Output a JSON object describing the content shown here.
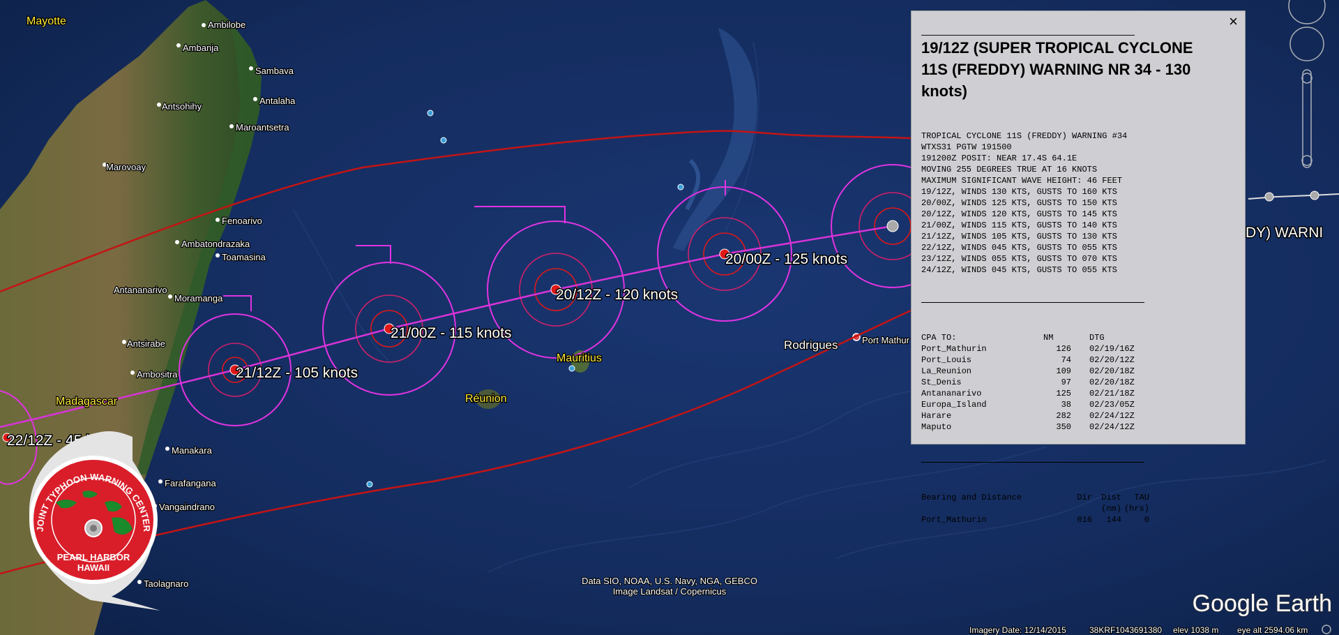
{
  "place_labels": [
    {
      "text": "Mayotte",
      "style": "yellow"
    },
    {
      "text": "Ambilobe",
      "style": "white"
    },
    {
      "text": "Ambanja",
      "style": "white"
    },
    {
      "text": "Sambava",
      "style": "white"
    },
    {
      "text": "Antsohihy",
      "style": "white"
    },
    {
      "text": "Antalaha",
      "style": "white"
    },
    {
      "text": "Maroantsetra",
      "style": "white"
    },
    {
      "text": "Marovoay",
      "style": "white"
    },
    {
      "text": "Fenoarivo",
      "style": "white"
    },
    {
      "text": "Ambatondrazaka",
      "style": "white"
    },
    {
      "text": "Toamasina",
      "style": "white"
    },
    {
      "text": "Antananarivo",
      "style": "white"
    },
    {
      "text": "Moramanga",
      "style": "white"
    },
    {
      "text": "Antsirabe",
      "style": "white"
    },
    {
      "text": "Ambositra",
      "style": "white"
    },
    {
      "text": "Madagascar",
      "style": "yellow"
    },
    {
      "text": "Manakara",
      "style": "white"
    },
    {
      "text": "Farafangana",
      "style": "white"
    },
    {
      "text": "Vangaindrano",
      "style": "white"
    },
    {
      "text": "Taolagnaro",
      "style": "white"
    },
    {
      "text": "Mauritius",
      "style": "yellow"
    },
    {
      "text": "Réunion",
      "style": "yellow"
    },
    {
      "text": "Rodrigues",
      "style": "white-large"
    },
    {
      "text": "Port Mathur",
      "style": "white"
    }
  ],
  "track_labels": [
    "20/00Z - 125 knots",
    "20/12Z - 120 knots",
    "21/00Z - 115 knots",
    "21/12Z - 105 knots",
    "22/12Z - 45 knots"
  ],
  "edge_label": "DY) WARNI",
  "seal": {
    "top_text": "JOINT TYPHOON WARNING CENTER",
    "line1": "PEARL HARBOR",
    "line2": "HAWAII"
  },
  "attribution": {
    "line1": "Data SIO, NOAA, U.S. Navy, NGA, GEBCO",
    "line2": "Image Landsat / Copernicus"
  },
  "brand": "Google Earth",
  "status_bar": {
    "imagery_date": "Imagery Date: 12/14/2015",
    "coords": "38KRF1043691380",
    "elev": "elev  1038 m",
    "eye_alt": "eye alt 2594.06 km"
  },
  "popup": {
    "close_label": "×",
    "title": "19/12Z (SUPER TROPICAL CYCLONE 11S (FREDDY) WARNING NR 34 - 130 knots)",
    "warning_lines": [
      "TROPICAL CYCLONE 11S (FREDDY) WARNING #34",
      "WTXS31 PGTW 191500",
      "191200Z POSIT: NEAR 17.4S 64.1E",
      "MOVING 255 DEGREES TRUE AT 16 KNOTS",
      "MAXIMUM SIGNIFICANT WAVE HEIGHT: 46 FEET",
      "19/12Z, WINDS 130 KTS, GUSTS TO 160 KTS",
      "20/00Z, WINDS 125 KTS, GUSTS TO 150 KTS",
      "20/12Z, WINDS 120 KTS, GUSTS TO 145 KTS",
      "21/00Z, WINDS 115 KTS, GUSTS TO 140 KTS",
      "21/12Z, WINDS 105 KTS, GUSTS TO 130 KTS",
      "22/12Z, WINDS 045 KTS, GUSTS TO 055 KTS",
      "23/12Z, WINDS 055 KTS, GUSTS TO 070 KTS",
      "24/12Z, WINDS 045 KTS, GUSTS TO 055 KTS"
    ],
    "cpa_headers": [
      "CPA TO:",
      "NM",
      "DTG"
    ],
    "cpa_rows": [
      [
        "Port_Mathurin",
        "126",
        "02/19/16Z"
      ],
      [
        "Port_Louis",
        "74",
        "02/20/12Z"
      ],
      [
        "La_Reunion",
        "109",
        "02/20/18Z"
      ],
      [
        "St_Denis",
        "97",
        "02/20/18Z"
      ],
      [
        "Antananarivo",
        "125",
        "02/21/18Z"
      ],
      [
        "Europa_Island",
        "38",
        "02/23/05Z"
      ],
      [
        "Harare",
        "282",
        "02/24/12Z"
      ],
      [
        "Maputo",
        "350",
        "02/24/12Z"
      ]
    ],
    "bd_headers": [
      "Bearing and Distance",
      "Dir",
      "Dist",
      "TAU"
    ],
    "bd_units": [
      "",
      "",
      "(nm)",
      "(hrs)"
    ],
    "bd_rows": [
      [
        "Port_Mathurin",
        "016",
        "144",
        "0"
      ]
    ]
  }
}
